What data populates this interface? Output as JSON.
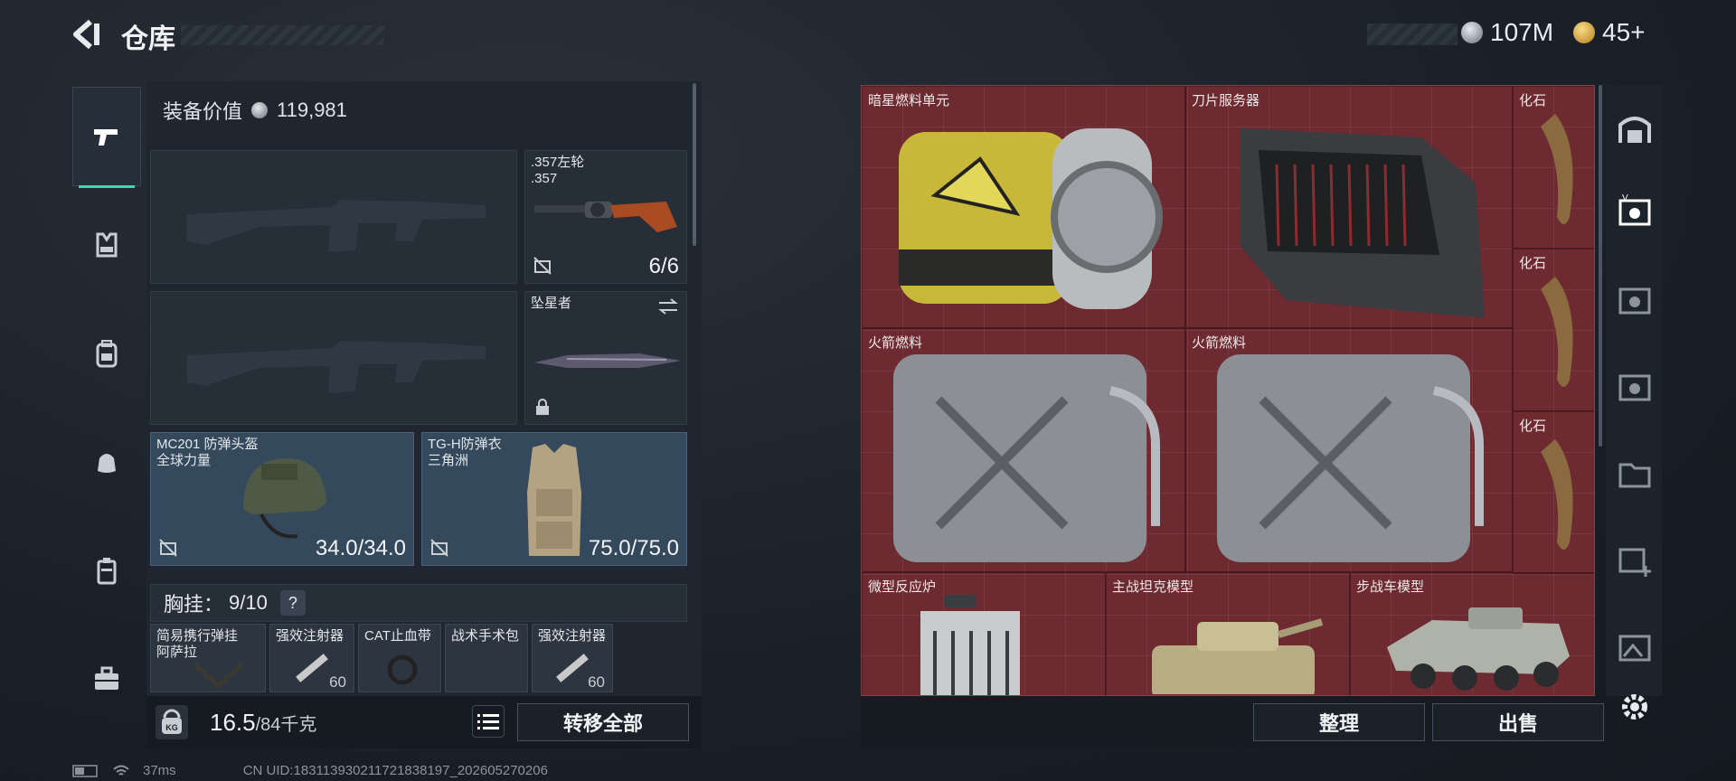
{
  "header": {
    "title": "仓库",
    "currency_silver": "107M",
    "currency_gold": "45+"
  },
  "equipment": {
    "value_label": "装备价值",
    "value": "119,981",
    "sidearm": {
      "name": ".357左轮",
      "sub": ".357",
      "ammo": "6/6"
    },
    "melee": {
      "name": "坠星者"
    },
    "helmet": {
      "name": "MC201 防弹头盔",
      "maker": "全球力量",
      "durability": "34.0/34.0"
    },
    "armor": {
      "name": "TG-H防弹衣",
      "maker": "三角洲",
      "durability": "75.0/75.0"
    },
    "chest_label": "胸挂：",
    "chest_count": "9/10",
    "chest_help": "?",
    "chest_items": [
      {
        "name": "简易携行弹挂",
        "sub": "阿萨拉"
      },
      {
        "name": "强效注射器",
        "qty": "60"
      },
      {
        "name": "CAT止血带"
      },
      {
        "name": "战术手术包"
      },
      {
        "name": "强效注射器",
        "qty": "60"
      }
    ],
    "weight_value": "16.5",
    "weight_max": "/84千克",
    "weight_icon": "KG",
    "transfer_all": "转移全部"
  },
  "storage": {
    "items": [
      {
        "name": "暗星燃料单元"
      },
      {
        "name": "刀片服务器"
      },
      {
        "name": "化石"
      },
      {
        "name": "化石"
      },
      {
        "name": "化石"
      },
      {
        "name": "火箭燃料"
      },
      {
        "name": "火箭燃料"
      },
      {
        "name": "微型反应炉"
      },
      {
        "name": "主战坦克模型"
      },
      {
        "name": "步战车模型"
      }
    ],
    "sort_label": "整理",
    "sell_label": "出售"
  },
  "status": {
    "ping": "37ms",
    "uid": "CN UID:18311393021172183819​7_202605270206"
  },
  "colors": {
    "accent": "#47d3b0",
    "storage_bg": "#6d2a30",
    "armor_slot": "#34495c"
  }
}
